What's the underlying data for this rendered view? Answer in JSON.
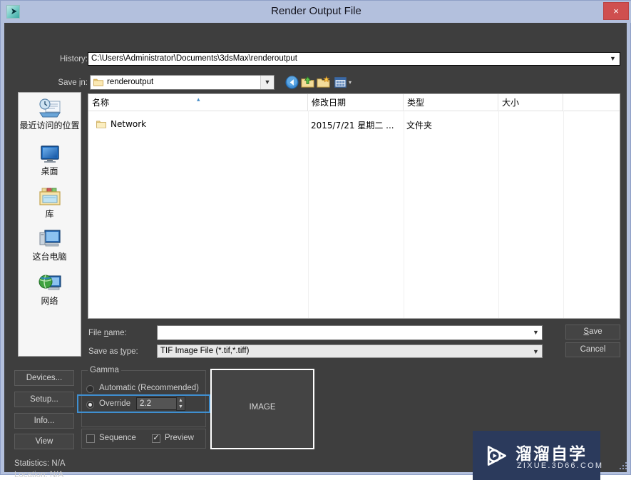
{
  "window": {
    "title": "Render Output File",
    "icon": "max-app-icon",
    "close_label": "×"
  },
  "history": {
    "label": "History:",
    "value": "C:\\Users\\Administrator\\Documents\\3dsMax\\renderoutput"
  },
  "save_in": {
    "label": "Save in:",
    "value": "renderoutput"
  },
  "toolbar": {
    "back": "back-icon",
    "up": "up-one-level-icon",
    "new_folder": "new-folder-icon",
    "views": "views-icon",
    "views_arrow": "▾"
  },
  "places": {
    "items": [
      {
        "label": "最近访问的位置",
        "icon": "recent-places-icon"
      },
      {
        "label": "桌面",
        "icon": "desktop-icon"
      },
      {
        "label": "库",
        "icon": "libraries-icon"
      },
      {
        "label": "这台电脑",
        "icon": "this-pc-icon"
      },
      {
        "label": "网络",
        "icon": "network-icon"
      }
    ]
  },
  "file_list": {
    "columns": [
      "名称",
      "修改日期",
      "类型",
      "大小",
      ""
    ],
    "sort_arrow": "▴",
    "rows": [
      {
        "name": "Network",
        "date": "2015/7/21 星期二 ...",
        "type": "文件夹",
        "size": "",
        "icon": "folder-icon"
      }
    ]
  },
  "file_name": {
    "label": "File name:",
    "value": "",
    "placeholder": ""
  },
  "save_as_type": {
    "label": "Save as type:",
    "value": "TIF Image File (*.tif,*.tiff)"
  },
  "actions": {
    "save": "Save",
    "cancel": "Cancel"
  },
  "side_buttons": {
    "devices": "Devices...",
    "setup": "Setup...",
    "info": "Info...",
    "view": "View"
  },
  "status": {
    "statistics_label": "Statistics:",
    "statistics_value": "N/A",
    "location_label": "Location:",
    "location_value": "N/A"
  },
  "gamma": {
    "legend": "Gamma",
    "automatic_label": "Automatic (Recommended)",
    "automatic_selected": false,
    "override_label": "Override",
    "override_selected": true,
    "override_value": "2.2",
    "spin_up": "▲",
    "spin_down": "▼",
    "highlight_color": "#3f8fd0"
  },
  "options": {
    "sequence_label": "Sequence",
    "sequence_checked": false,
    "preview_label": "Preview",
    "preview_checked": true
  },
  "preview_box": {
    "text": "IMAGE"
  },
  "watermark": {
    "chinese": "溜溜自学",
    "english": "ZIXUE.3D66.COM",
    "background": "#2b3a5c",
    "logo": "play-button-logo"
  },
  "colors": {
    "titlebar": "#b3c0dd",
    "dialog_background": "#3e3e3e",
    "close_button": "#cf4f4f",
    "accent": "#3f8fd0"
  }
}
